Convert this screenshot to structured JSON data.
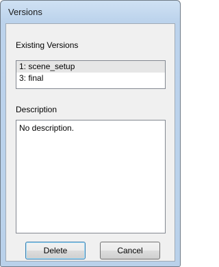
{
  "window": {
    "title": "Versions"
  },
  "existing": {
    "label": "Existing Versions",
    "items": [
      {
        "label": "1: scene_setup",
        "selected": true
      },
      {
        "label": "3: final",
        "selected": false
      }
    ]
  },
  "description": {
    "label": "Description",
    "value": "No description."
  },
  "buttons": {
    "delete_label": "Delete",
    "cancel_label": "Cancel"
  }
}
